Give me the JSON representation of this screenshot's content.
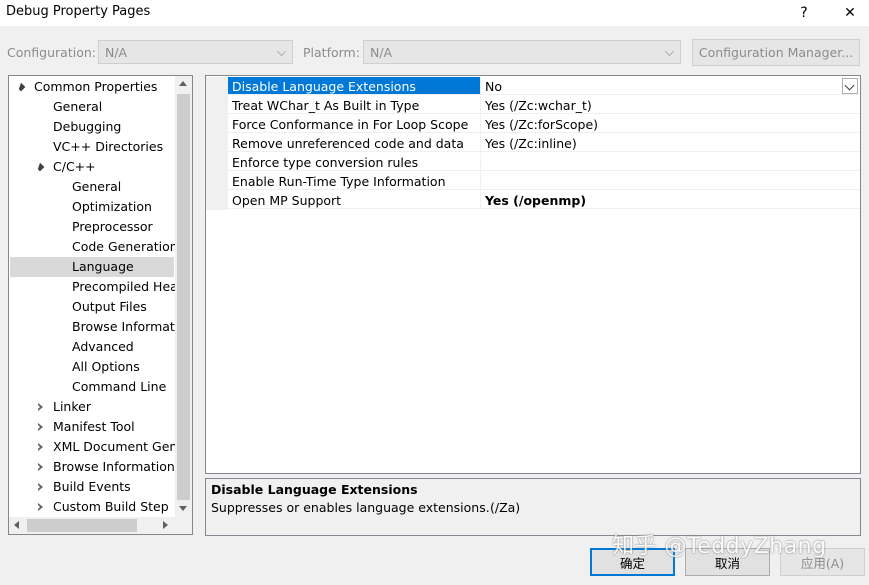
{
  "window": {
    "title": "Debug Property Pages",
    "help_glyph": "?",
    "close_glyph": "✕"
  },
  "toolbar": {
    "configuration_label": "Configuration:",
    "configuration_value": "N/A",
    "platform_label": "Platform:",
    "platform_value": "N/A",
    "config_manager_label": "Configuration Manager..."
  },
  "tree": {
    "items": [
      {
        "label": "Common Properties"
      },
      {
        "label": "General"
      },
      {
        "label": "Debugging"
      },
      {
        "label": "VC++ Directories"
      },
      {
        "label": "C/C++"
      },
      {
        "label": "General"
      },
      {
        "label": "Optimization"
      },
      {
        "label": "Preprocessor"
      },
      {
        "label": "Code Generation"
      },
      {
        "label": "Language"
      },
      {
        "label": "Precompiled Heac"
      },
      {
        "label": "Output Files"
      },
      {
        "label": "Browse Informatic"
      },
      {
        "label": "Advanced"
      },
      {
        "label": "All Options"
      },
      {
        "label": "Command Line"
      },
      {
        "label": "Linker"
      },
      {
        "label": "Manifest Tool"
      },
      {
        "label": "XML Document Gene"
      },
      {
        "label": "Browse Information"
      },
      {
        "label": "Build Events"
      },
      {
        "label": "Custom Build Step"
      }
    ]
  },
  "properties": [
    {
      "name": "Disable Language Extensions",
      "value": "No"
    },
    {
      "name": "Treat WChar_t As Built in Type",
      "value": "Yes (/Zc:wchar_t)"
    },
    {
      "name": "Force Conformance in For Loop Scope",
      "value": "Yes (/Zc:forScope)"
    },
    {
      "name": "Remove unreferenced code and data",
      "value": "Yes (/Zc:inline)"
    },
    {
      "name": "Enforce type conversion rules",
      "value": ""
    },
    {
      "name": "Enable Run-Time Type Information",
      "value": ""
    },
    {
      "name": "Open MP Support",
      "value": "Yes (/openmp)"
    }
  ],
  "description": {
    "title": "Disable Language Extensions",
    "text": "Suppresses or enables language extensions.",
    "flag": "(/Za)"
  },
  "buttons": {
    "ok": "确定",
    "cancel": "取消",
    "apply": "应用(A)"
  },
  "watermark": "知乎 @TeddyZhang",
  "colors": {
    "selection": "#0078d7",
    "tree_selection": "#d9d9d9"
  }
}
